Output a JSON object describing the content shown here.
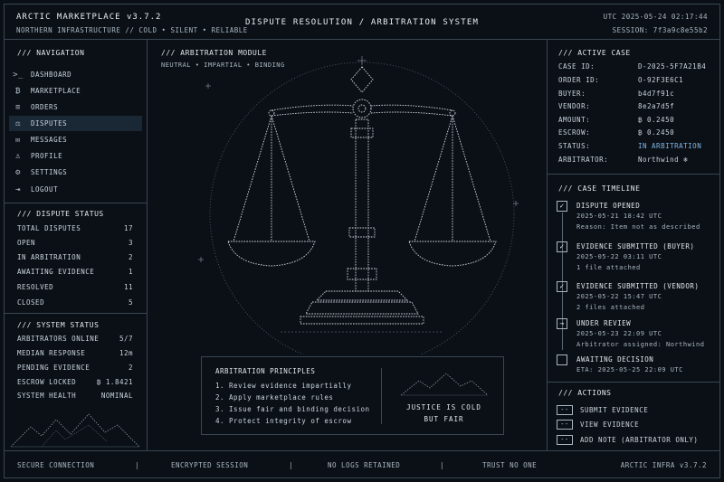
{
  "header": {
    "app_title": "ARCTIC MARKETPLACE  v3.7.2",
    "tagline": "NORTHERN INFRASTRUCTURE // COLD • SILENT • RELIABLE",
    "center_title": "DISPUTE RESOLUTION / ARBITRATION SYSTEM",
    "utc": "UTC 2025-05-24  02:17:44",
    "session": "SESSION: 7f3a9c8e55b2"
  },
  "navigation": {
    "title": "/// NAVIGATION",
    "items": [
      {
        "label": "DASHBOARD",
        "icon": ">_"
      },
      {
        "label": "MARKETPLACE",
        "icon": "₿"
      },
      {
        "label": "ORDERS",
        "icon": "≡"
      },
      {
        "label": "DISPUTES",
        "icon": "⚖"
      },
      {
        "label": "MESSAGES",
        "icon": "✉"
      },
      {
        "label": "PROFILE",
        "icon": "♙"
      },
      {
        "label": "SETTINGS",
        "icon": "⚙"
      },
      {
        "label": "LOGOUT",
        "icon": "⇥"
      }
    ]
  },
  "dispute_status": {
    "title": "/// DISPUTE STATUS",
    "rows": [
      {
        "label": "TOTAL DISPUTES",
        "value": "17"
      },
      {
        "label": "OPEN",
        "value": "3"
      },
      {
        "label": "IN ARBITRATION",
        "value": "2"
      },
      {
        "label": "AWAITING EVIDENCE",
        "value": "1"
      },
      {
        "label": "RESOLVED",
        "value": "11"
      },
      {
        "label": "CLOSED",
        "value": "5"
      }
    ]
  },
  "system_status": {
    "title": "/// SYSTEM STATUS",
    "rows": [
      {
        "label": "ARBITRATORS ONLINE",
        "value": "5/7"
      },
      {
        "label": "MEDIAN RESPONSE",
        "value": "12m"
      },
      {
        "label": "PENDING EVIDENCE",
        "value": "2"
      },
      {
        "label": "ESCROW LOCKED",
        "value": "₿ 1.8421"
      },
      {
        "label": "SYSTEM HEALTH",
        "value": "NOMINAL"
      }
    ]
  },
  "module": {
    "title": "/// ARBITRATION MODULE",
    "subtitle": "NEUTRAL • IMPARTIAL • BINDING"
  },
  "principles": {
    "title": "ARBITRATION PRINCIPLES",
    "items": [
      "1. Review evidence impartially",
      "2. Apply marketplace rules",
      "3. Issue fair and binding decision",
      "4. Protect integrity of escrow"
    ],
    "quote_line1": "JUSTICE IS COLD",
    "quote_line2": "BUT FAIR"
  },
  "active_case": {
    "title": "/// ACTIVE CASE",
    "rows": [
      {
        "label": "CASE ID:",
        "value": "D-2025-5F7A21B4"
      },
      {
        "label": "ORDER ID:",
        "value": "O-92F3E6C1"
      },
      {
        "label": "BUYER:",
        "value": "b4d7f91c"
      },
      {
        "label": "VENDOR:",
        "value": "8e2a7d5f"
      },
      {
        "label": "AMOUNT:",
        "value": "₿ 0.2450"
      },
      {
        "label": "ESCROW:",
        "value": "₿ 0.2450"
      },
      {
        "label": "STATUS:",
        "value": "IN ARBITRATION"
      },
      {
        "label": "ARBITRATOR:",
        "value": "Northwind ❄"
      }
    ],
    "status_color": "#7fb7e8"
  },
  "timeline": {
    "title": "/// CASE TIMELINE",
    "items": [
      {
        "mark": "✓",
        "title": "DISPUTE OPENED",
        "date": "2025-05-21 18:42 UTC",
        "note": "Reason: Item not as described"
      },
      {
        "mark": "✓",
        "title": "EVIDENCE SUBMITTED (BUYER)",
        "date": "2025-05-22 03:11 UTC",
        "note": "1 file attached"
      },
      {
        "mark": "✓",
        "title": "EVIDENCE SUBMITTED (VENDOR)",
        "date": "2025-05-22 15:47 UTC",
        "note": "2 files attached"
      },
      {
        "mark": "→",
        "title": "UNDER REVIEW",
        "date": "2025-05-23 22:09 UTC",
        "note": "Arbitrator assigned: Northwind"
      },
      {
        "mark": "",
        "title": "AWAITING DECISION",
        "date": "ETA: 2025-05-25 22:09 UTC",
        "note": ""
      }
    ]
  },
  "actions": {
    "title": "/// ACTIONS",
    "items": [
      {
        "button": "--",
        "label": "SUBMIT EVIDENCE"
      },
      {
        "button": "--",
        "label": "VIEW EVIDENCE"
      },
      {
        "button": "--",
        "label": "ADD NOTE (ARBITRATOR ONLY)"
      }
    ]
  },
  "footer": {
    "items": [
      "SECURE CONNECTION",
      "|",
      "ENCRYPTED SESSION",
      "|",
      "NO LOGS RETAINED",
      "|",
      "TRUST NO ONE"
    ],
    "right": "ARCTIC INFRA v3.7.2"
  }
}
